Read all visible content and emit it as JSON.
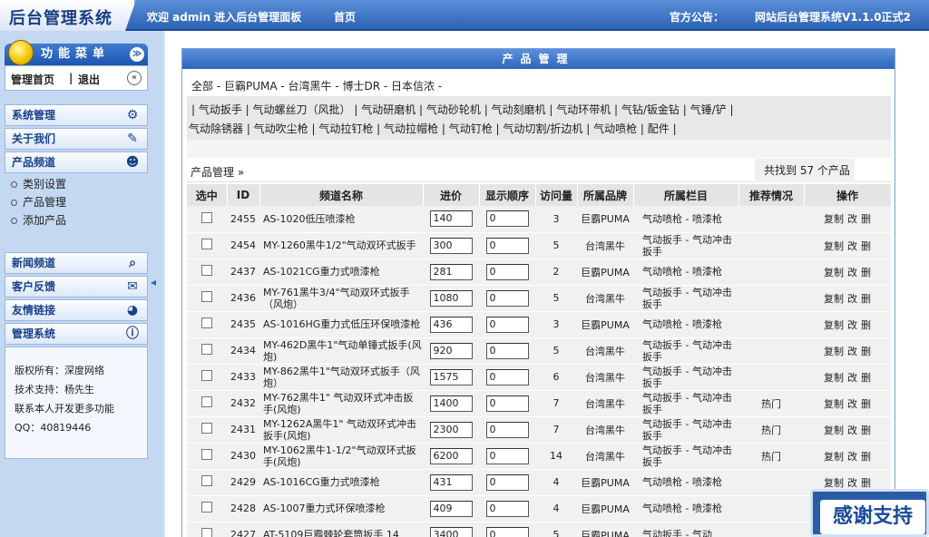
{
  "header": {
    "logo": "后台管理系统",
    "welcome": "欢迎 admin 进入后台管理面板",
    "home": "首页",
    "notice_label": "官方公告：",
    "notice_text": "网站后台管理系统V1.1.0正式2"
  },
  "sidebar": {
    "menu_title": "功能菜单",
    "nav": {
      "home": "管理首页",
      "sep": "|",
      "logout": "退出"
    },
    "groups": [
      {
        "label": "系统管理",
        "icon": "tools-icon"
      },
      {
        "label": "关于我们",
        "icon": "edit-icon"
      },
      {
        "label": "产品频道",
        "icon": "user-icon"
      }
    ],
    "sub_items": [
      "类别设置",
      "产品管理",
      "添加产品"
    ],
    "groups2": [
      {
        "label": "新闻频道",
        "icon": "search-icon"
      },
      {
        "label": "客户反馈",
        "icon": "feedback-icon"
      },
      {
        "label": "友情链接",
        "icon": "globe-icon"
      },
      {
        "label": "管理系统",
        "icon": "info-icon"
      }
    ],
    "info": [
      "版权所有：深度网络",
      "技术支持：杨先生",
      "联系本人开发更多功能",
      "QQ：40819446"
    ]
  },
  "panel": {
    "title": "产品管理",
    "brands": "全部 - 巨霸PUMA - 台湾黑牛 - 博士DR - 日本信浓 -",
    "cat_row1": "| 气动扳手 | 气动螺丝刀（风批） | 气动研磨机 | 气动砂轮机 | 气动刻磨机 | 气动环带机 | 气钻/钣金钻 | 气锤/铲 |",
    "cat_row2": "气动除锈器 | 气动吹尘枪 | 气动拉钉枪 | 气动拉帽枪 | 气动钉枪 | 气动切割/折边机 | 气动喷枪 | 配件 |",
    "crumb": "产品管理 »",
    "found": "共找到 57 个产品"
  },
  "table": {
    "headers": [
      "选中",
      "ID",
      "频道名称",
      "进价",
      "显示顺序",
      "访问量",
      "所属品牌",
      "所属栏目",
      "推荐情况",
      "操作"
    ],
    "ops": [
      "复制",
      "改",
      "删"
    ],
    "rows": [
      {
        "id": "2455",
        "name": "AS-1020低压喷漆枪",
        "price": "140",
        "order": "0",
        "visits": "3",
        "brand": "巨霸PUMA",
        "cat": "气动喷枪 - 喷漆枪",
        "rec": ""
      },
      {
        "id": "2454",
        "name": "MY-1260黑牛1/2\"气动双环式扳手",
        "price": "300",
        "order": "0",
        "visits": "5",
        "brand": "台湾黑牛",
        "cat": "气动扳手 - 气动冲击扳手",
        "rec": ""
      },
      {
        "id": "2437",
        "name": "AS-1021CG重力式喷漆枪",
        "price": "281",
        "order": "0",
        "visits": "2",
        "brand": "巨霸PUMA",
        "cat": "气动喷枪 - 喷漆枪",
        "rec": ""
      },
      {
        "id": "2436",
        "name": "MY-761黑牛3/4\"气动双环式扳手（风炮）",
        "price": "1080",
        "order": "0",
        "visits": "5",
        "brand": "台湾黑牛",
        "cat": "气动扳手 - 气动冲击扳手",
        "rec": ""
      },
      {
        "id": "2435",
        "name": "AS-1016HG重力式低压环保喷漆枪",
        "price": "436",
        "order": "0",
        "visits": "3",
        "brand": "巨霸PUMA",
        "cat": "气动喷枪 - 喷漆枪",
        "rec": ""
      },
      {
        "id": "2434",
        "name": "MY-462D黑牛1\"气动单锤式扳手(风炮)",
        "price": "920",
        "order": "0",
        "visits": "5",
        "brand": "台湾黑牛",
        "cat": "气动扳手 - 气动冲击扳手",
        "rec": ""
      },
      {
        "id": "2433",
        "name": "MY-862黑牛1\"气动双环式扳手（风炮）",
        "price": "1575",
        "order": "0",
        "visits": "6",
        "brand": "台湾黑牛",
        "cat": "气动扳手 - 气动冲击扳手",
        "rec": ""
      },
      {
        "id": "2432",
        "name": "MY-762黑牛1\" 气动双环式冲击扳手(风炮)",
        "price": "1400",
        "order": "0",
        "visits": "7",
        "brand": "台湾黑牛",
        "cat": "气动扳手 - 气动冲击扳手",
        "rec": "热门"
      },
      {
        "id": "2431",
        "name": "MY-1262A黑牛1\" 气动双环式冲击扳手(风炮)",
        "price": "2300",
        "order": "0",
        "visits": "7",
        "brand": "台湾黑牛",
        "cat": "气动扳手 - 气动冲击扳手",
        "rec": "热门"
      },
      {
        "id": "2430",
        "name": "MY-1062黑牛1-1/2\"气动双环式扳手(风炮)",
        "price": "6200",
        "order": "0",
        "visits": "14",
        "brand": "台湾黑牛",
        "cat": "气动扳手 - 气动冲击扳手",
        "rec": "热门"
      },
      {
        "id": "2429",
        "name": "AS-1016CG重力式喷漆枪",
        "price": "431",
        "order": "0",
        "visits": "4",
        "brand": "巨霸PUMA",
        "cat": "气动喷枪 - 喷漆枪",
        "rec": ""
      },
      {
        "id": "2428",
        "name": "AS-1007重力式环保喷漆枪",
        "price": "409",
        "order": "0",
        "visits": "4",
        "brand": "巨霸PUMA",
        "cat": "气动喷枪 - 喷漆枪",
        "rec": ""
      },
      {
        "id": "2427",
        "name": "AT-5109巨霸棘轮套筒扳手 14",
        "price": "3400",
        "order": "0",
        "visits": "5",
        "brand": "巨霸PUMA",
        "cat": "气动扳手 - 气动",
        "rec": ""
      }
    ]
  },
  "badge": {
    "text": "感谢支持"
  }
}
